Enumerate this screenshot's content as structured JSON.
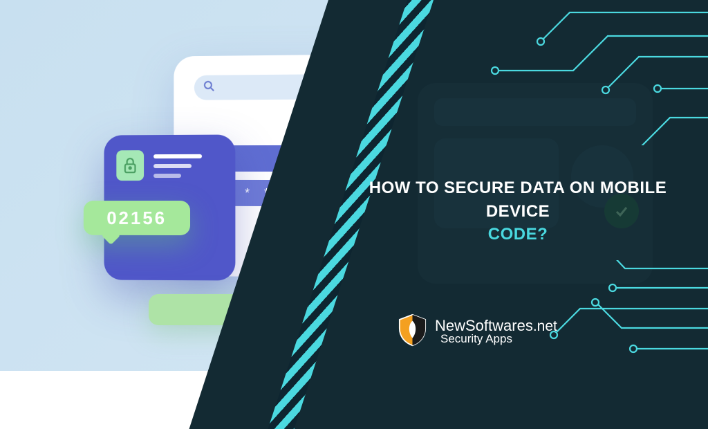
{
  "headline": {
    "line1": "HOW TO SECURE DATA ON MOBILE DEVICE",
    "line2": "CODE?"
  },
  "illustration": {
    "otp_code": "02156",
    "password_mask": "* * * * * * *"
  },
  "logo": {
    "brand_main": "NewSoftwares",
    "brand_tld": ".net",
    "tagline": "Security Apps"
  },
  "colors": {
    "dark": "#132a33",
    "accent": "#4bd9e0",
    "green": "#a5e89b",
    "indigo": "#5057c9",
    "light_bg": "#d5e7f5"
  }
}
